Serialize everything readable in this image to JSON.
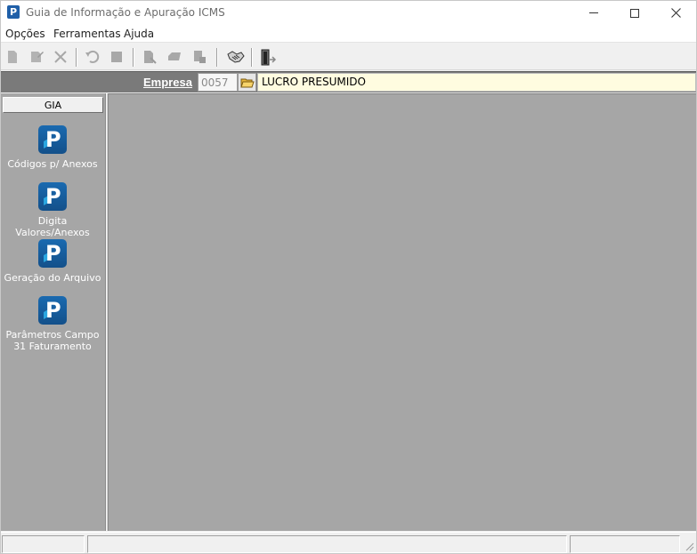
{
  "window": {
    "title": "Guia de Informação e Apuração ICMS",
    "app_icon_letter": "P",
    "accent_color": "#1f5fa8"
  },
  "menu": {
    "items": [
      "Opções",
      "Ferramentas",
      "Ajuda"
    ]
  },
  "toolbar": {
    "buttons": [
      {
        "icon": "new-document-icon",
        "enabled": false
      },
      {
        "icon": "edit-document-icon",
        "enabled": false
      },
      {
        "icon": "delete-x-icon",
        "enabled": false
      },
      {
        "icon": "undo-icon",
        "enabled": false
      },
      {
        "icon": "stop-icon",
        "enabled": false
      },
      {
        "icon": "report-icon",
        "enabled": false
      },
      {
        "icon": "print-icon",
        "enabled": false
      },
      {
        "icon": "print-preview-icon",
        "enabled": false
      },
      {
        "icon": "handshake-icon",
        "enabled": true
      },
      {
        "icon": "exit-door-icon",
        "enabled": true
      }
    ]
  },
  "empresa": {
    "label": "Empresa",
    "code": "0057",
    "name": "LUCRO PRESUMIDO"
  },
  "sidebar": {
    "header": "GIA",
    "items": [
      {
        "label": "Códigos p/ Anexos",
        "icon": "p-app-icon"
      },
      {
        "label": "Digita Valores/Anexos",
        "icon": "p-app-icon"
      },
      {
        "label": "Geração do Arquivo",
        "icon": "p-app-icon"
      },
      {
        "label": "Parâmetros Campo 31 Faturamento",
        "icon": "p-app-icon"
      }
    ]
  },
  "colors": {
    "workspace": "#a6a6a6",
    "empresa_bar": "#7a7a7a",
    "empresa_name_bg": "#fffce0",
    "icon_blue": "#1a6ab0",
    "icon_accent": "#2aa6e0"
  }
}
